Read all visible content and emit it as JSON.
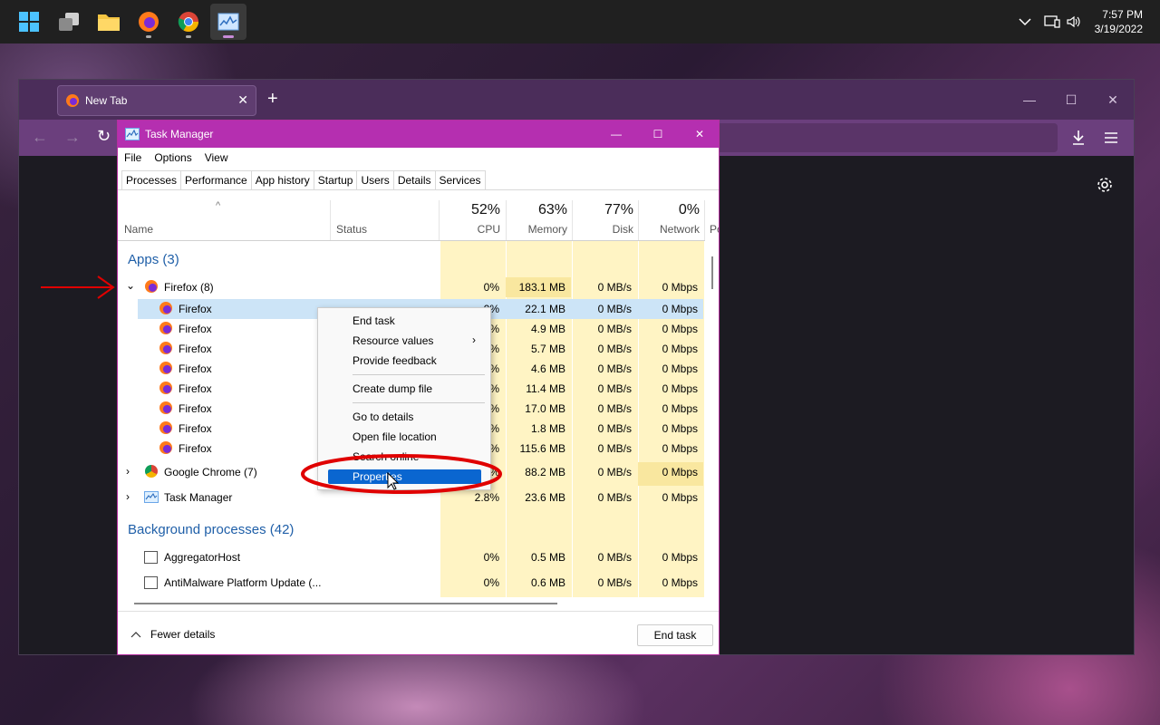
{
  "taskbar": {
    "time": "7:57 PM",
    "date": "3/19/2022",
    "apps": [
      "start-icon",
      "task-view-icon",
      "file-explorer-icon",
      "firefox-icon",
      "chrome-icon",
      "task-manager-icon"
    ]
  },
  "browser": {
    "tab_title": "New Tab",
    "new_tab_symbol": "+"
  },
  "taskmanager": {
    "title": "Task Manager",
    "menu": [
      "File",
      "Options",
      "View"
    ],
    "tabs": [
      "Processes",
      "Performance",
      "App history",
      "Startup",
      "Users",
      "Details",
      "Services"
    ],
    "columns": {
      "name": "Name",
      "status": "Status",
      "cpu_pct": "52%",
      "cpu": "CPU",
      "mem_pct": "63%",
      "mem": "Memory",
      "disk_pct": "77%",
      "disk": "Disk",
      "net_pct": "0%",
      "net": "Network",
      "power_cut": "Po"
    },
    "sections": {
      "apps": "Apps (3)",
      "background": "Background processes (42)"
    },
    "rows": [
      {
        "name": "Firefox (8)",
        "cpu": "0%",
        "mem": "183.1 MB",
        "disk": "0 MB/s",
        "net": "0 Mbps"
      },
      {
        "name": "Firefox",
        "cpu": "0%",
        "mem": "22.1 MB",
        "disk": "0 MB/s",
        "net": "0 Mbps"
      },
      {
        "name": "Firefox",
        "cpu": "%",
        "mem": "4.9 MB",
        "disk": "0 MB/s",
        "net": "0 Mbps"
      },
      {
        "name": "Firefox",
        "cpu": "%",
        "mem": "5.7 MB",
        "disk": "0 MB/s",
        "net": "0 Mbps"
      },
      {
        "name": "Firefox",
        "cpu": "%",
        "mem": "4.6 MB",
        "disk": "0 MB/s",
        "net": "0 Mbps"
      },
      {
        "name": "Firefox",
        "cpu": "%",
        "mem": "11.4 MB",
        "disk": "0 MB/s",
        "net": "0 Mbps"
      },
      {
        "name": "Firefox",
        "cpu": "%",
        "mem": "17.0 MB",
        "disk": "0 MB/s",
        "net": "0 Mbps"
      },
      {
        "name": "Firefox",
        "cpu": "%",
        "mem": "1.8 MB",
        "disk": "0 MB/s",
        "net": "0 Mbps"
      },
      {
        "name": "Firefox",
        "cpu": "%",
        "mem": "115.6 MB",
        "disk": "0 MB/s",
        "net": "0 Mbps"
      },
      {
        "name": "Google Chrome (7)",
        "cpu": "%",
        "mem": "88.2 MB",
        "disk": "0 MB/s",
        "net": "0 Mbps"
      },
      {
        "name": "Task Manager",
        "cpu": "2.8%",
        "mem": "23.6 MB",
        "disk": "0 MB/s",
        "net": "0 Mbps"
      },
      {
        "name": "AggregatorHost",
        "cpu": "0%",
        "mem": "0.5 MB",
        "disk": "0 MB/s",
        "net": "0 Mbps"
      },
      {
        "name": "AntiMalware Platform Update (...",
        "cpu": "0%",
        "mem": "0.6 MB",
        "disk": "0 MB/s",
        "net": "0 Mbps"
      }
    ],
    "footer": {
      "fewer": "Fewer details",
      "end_task": "End task"
    }
  },
  "context_menu": {
    "items": [
      "End task",
      "Resource values",
      "Provide feedback",
      "Create dump file",
      "Go to details",
      "Open file location",
      "Search online",
      "Properties"
    ]
  },
  "colors": {
    "tm_titlebar": "#b52fb0",
    "heat": "#fff4c4",
    "heat_strong": "#f9e79f",
    "selection": "#cce4f7",
    "annotation": "#e00000"
  }
}
